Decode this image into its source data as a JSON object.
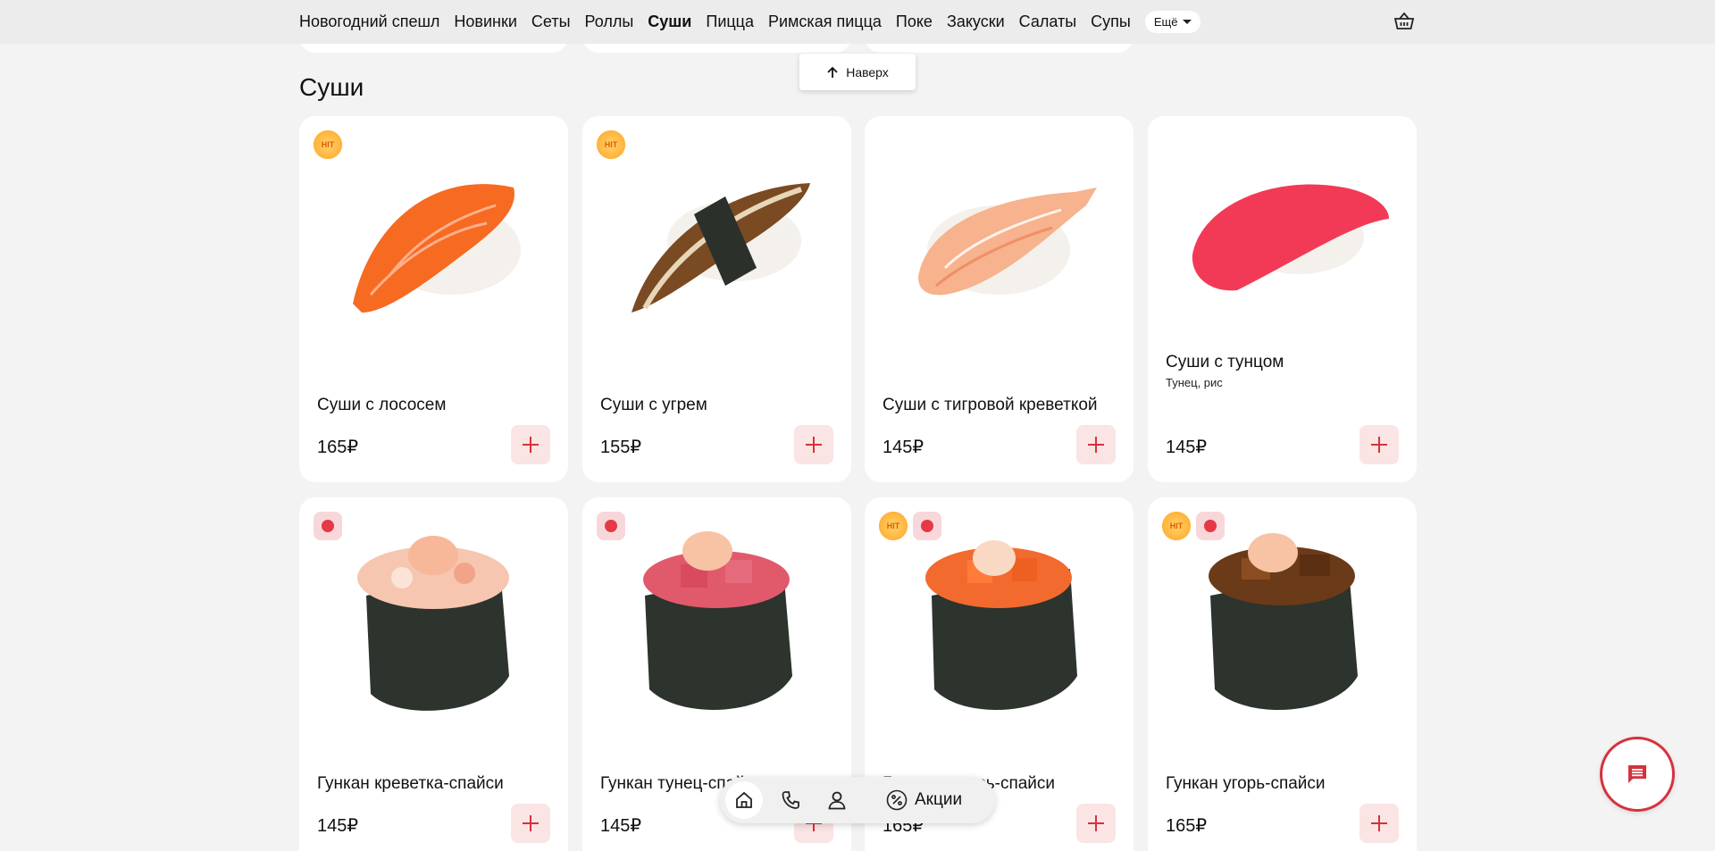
{
  "nav": {
    "items": [
      "Новогодний спешл",
      "Новинки",
      "Сеты",
      "Роллы",
      "Суши",
      "Пицца",
      "Римская пицца",
      "Поке",
      "Закуски",
      "Салаты",
      "Супы"
    ],
    "active": "Суши",
    "more_label": "Ещё"
  },
  "scroll_top_label": "Наверх",
  "section_title": "Суши",
  "products": [
    {
      "name": "Суши с лососем",
      "desc": "",
      "price": "165₽",
      "badges": [
        "hit"
      ]
    },
    {
      "name": "Суши с угрем",
      "desc": "",
      "price": "155₽",
      "badges": [
        "hit"
      ]
    },
    {
      "name": "Суши с тигровой креветкой",
      "desc": "",
      "price": "145₽",
      "badges": []
    },
    {
      "name": "Суши с тунцом",
      "desc": "Тунец, рис",
      "price": "145₽",
      "badges": []
    },
    {
      "name": "Гункан креветка-спайси",
      "desc": "",
      "price": "145₽",
      "badges": [
        "spicy"
      ]
    },
    {
      "name": "Гункан тунец-спайси",
      "desc": "",
      "price": "145₽",
      "badges": [
        "spicy"
      ]
    },
    {
      "name": "Гункан лосось-спайси",
      "desc": "",
      "price": "165₽",
      "badges": [
        "hit",
        "spicy"
      ]
    },
    {
      "name": "Гункан угорь-спайси",
      "desc": "",
      "price": "165₽",
      "badges": [
        "hit",
        "spicy"
      ]
    }
  ],
  "badge_text": {
    "hit": "HIT"
  },
  "bottom_nav": {
    "promo_label": "Акции"
  },
  "icons": [
    "basket-icon",
    "arrow-up-icon",
    "plus-icon",
    "home-icon",
    "phone-icon",
    "user-icon",
    "percent-icon",
    "chat-icon",
    "hit-badge-icon",
    "spicy-badge-icon"
  ],
  "colors": {
    "accent": "#d6323c",
    "add_bg": "#fae4e4",
    "page_bg": "#f3f3f3"
  }
}
